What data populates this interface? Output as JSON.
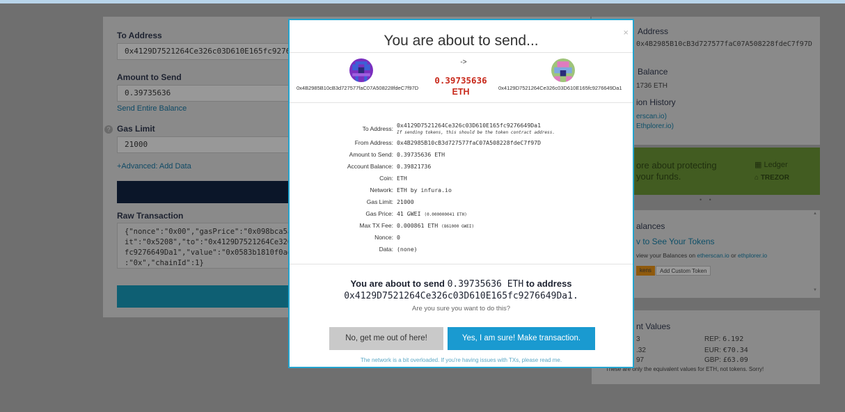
{
  "form": {
    "to_address_label": "To Address",
    "to_address_value": "0x4129D7521264Ce326c03D610E165fc9276649Da1",
    "amount_label": "Amount to Send",
    "amount_value": "0.39735636",
    "send_entire_balance": "Send Entire Balance",
    "gas_limit_label": "Gas Limit",
    "gas_limit_value": "21000",
    "advanced_link": "+Advanced: Add Data",
    "raw_tx_label": "Raw Transaction",
    "raw_tx_text": "{\"nonce\":\"0x00\",\"gasPrice\":\"0x098bca5a00\nit\":\"0x5208\",\"to\":\"0x4129D7521264Ce326c0\nfc9276649Da1\",\"value\":\"0x0583b1810f0ad00\n:\"0x\",\"chainId\":1}"
  },
  "sidebar": {
    "address_title": "Address",
    "address_value": "0x4B2985B10cB3d727577faC07A508228fdeC7f97D",
    "balance_title": "Balance",
    "balance_value": "1736 ETH",
    "history_title": "ion History",
    "history_link1": "erscan.io)",
    "history_link2": "Ethplorer.io)",
    "banner_line1": "ore about protecting",
    "banner_line2": "your funds.",
    "ledger": "Ledger",
    "trezor": "TREZOR",
    "dots": "• •",
    "token_title": "alances",
    "token_link": "v to See Your Tokens",
    "token_text_prefix": "view your Balances on ",
    "token_etherscan": "etherscan.io",
    "token_or": " or ",
    "token_ethplorer": "ethplorer.io",
    "token_btn1": "kens",
    "token_btn2": "Add Custom Token",
    "equiv_title": "nt Values",
    "equiv_rows": [
      {
        "left": "3",
        "right_label": "REP: ",
        "right_value": "6.192"
      },
      {
        "left": ".32",
        "right_label": "EUR: ",
        "right_value": "€70.34"
      },
      {
        "left": "97",
        "right_label": "GBP: ",
        "right_value": "£63.09"
      }
    ],
    "equiv_note": "These are only the equivalent values for ETH, not tokens. Sorry!"
  },
  "modal": {
    "title": "You are about to send...",
    "close": "×",
    "from_address": "0x4B2985B10cB3d727577faC07A508228fdeC7f97D",
    "to_address": "0x4129D7521264Ce326c03D610E165fc9276649Da1",
    "arrow": "->",
    "amount": "0.39735636",
    "unit": "ETH",
    "details": {
      "to_label": "To Address:",
      "to_value": "0x4129D7521264Ce326c03D610E165fc9276649Da1",
      "to_note": "If sending tokens, this should be the token contract address.",
      "from_label": "From Address:",
      "from_value": "0x4B2985B10cB3d727577faC07A508228fdeC7f97D",
      "amount_label": "Amount to Send:",
      "amount_value": "0.39735636 ETH",
      "balance_label": "Account Balance:",
      "balance_value": "0.39821736",
      "coin_label": "Coin:",
      "coin_value": "ETH",
      "network_label": "Network:",
      "network_value": "ETH by infura.io",
      "gas_limit_label": "Gas Limit:",
      "gas_limit_value": "21000",
      "gas_price_label": "Gas Price:",
      "gas_price_value": "41 GWEI",
      "gas_price_small": "(0.000000041 ETH)",
      "max_fee_label": "Max TX Fee:",
      "max_fee_value": "0.000861 ETH",
      "max_fee_small": "(861000 GWEI)",
      "nonce_label": "Nonce:",
      "nonce_value": "0",
      "data_label": "Data:",
      "data_value": "(none)"
    },
    "confirm_prefix": "You are about to send ",
    "confirm_amount": "0.39735636 ETH",
    "confirm_mid": " to address",
    "confirm_address": "0x4129D7521264Ce326c03D610E165fc9276649Da1.",
    "confirm_question": "Are you sure you want to do this?",
    "no_button": "No, get me out of here!",
    "yes_button": "Yes, I am sure! Make transaction.",
    "footer": "The network is a bit overloaded. If you're having issues with TXs, please read me."
  },
  "colors": {
    "accent": "#1a9ad0",
    "amount_red": "#c8291b",
    "modal_border": "#23a5d0"
  }
}
